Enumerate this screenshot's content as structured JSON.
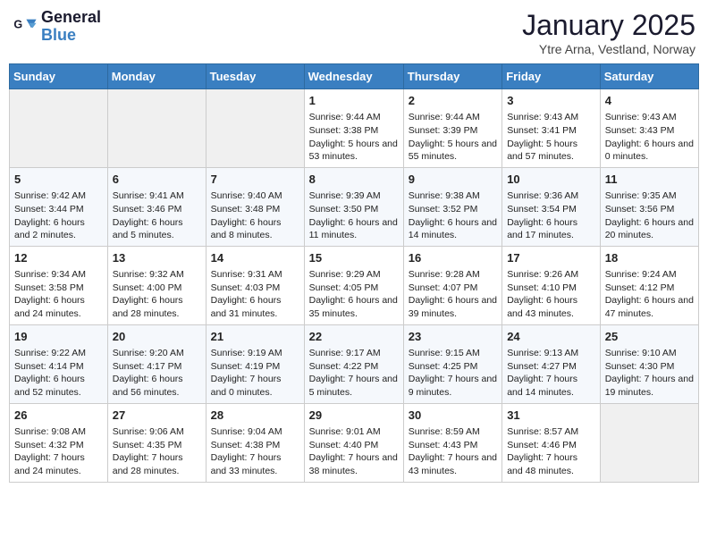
{
  "logo": {
    "line1": "General",
    "line2": "Blue"
  },
  "title": "January 2025",
  "subtitle": "Ytre Arna, Vestland, Norway",
  "days_of_week": [
    "Sunday",
    "Monday",
    "Tuesday",
    "Wednesday",
    "Thursday",
    "Friday",
    "Saturday"
  ],
  "weeks": [
    [
      {
        "day": "",
        "info": ""
      },
      {
        "day": "",
        "info": ""
      },
      {
        "day": "",
        "info": ""
      },
      {
        "day": "1",
        "info": "Sunrise: 9:44 AM\nSunset: 3:38 PM\nDaylight: 5 hours and 53 minutes."
      },
      {
        "day": "2",
        "info": "Sunrise: 9:44 AM\nSunset: 3:39 PM\nDaylight: 5 hours and 55 minutes."
      },
      {
        "day": "3",
        "info": "Sunrise: 9:43 AM\nSunset: 3:41 PM\nDaylight: 5 hours and 57 minutes."
      },
      {
        "day": "4",
        "info": "Sunrise: 9:43 AM\nSunset: 3:43 PM\nDaylight: 6 hours and 0 minutes."
      }
    ],
    [
      {
        "day": "5",
        "info": "Sunrise: 9:42 AM\nSunset: 3:44 PM\nDaylight: 6 hours and 2 minutes."
      },
      {
        "day": "6",
        "info": "Sunrise: 9:41 AM\nSunset: 3:46 PM\nDaylight: 6 hours and 5 minutes."
      },
      {
        "day": "7",
        "info": "Sunrise: 9:40 AM\nSunset: 3:48 PM\nDaylight: 6 hours and 8 minutes."
      },
      {
        "day": "8",
        "info": "Sunrise: 9:39 AM\nSunset: 3:50 PM\nDaylight: 6 hours and 11 minutes."
      },
      {
        "day": "9",
        "info": "Sunrise: 9:38 AM\nSunset: 3:52 PM\nDaylight: 6 hours and 14 minutes."
      },
      {
        "day": "10",
        "info": "Sunrise: 9:36 AM\nSunset: 3:54 PM\nDaylight: 6 hours and 17 minutes."
      },
      {
        "day": "11",
        "info": "Sunrise: 9:35 AM\nSunset: 3:56 PM\nDaylight: 6 hours and 20 minutes."
      }
    ],
    [
      {
        "day": "12",
        "info": "Sunrise: 9:34 AM\nSunset: 3:58 PM\nDaylight: 6 hours and 24 minutes."
      },
      {
        "day": "13",
        "info": "Sunrise: 9:32 AM\nSunset: 4:00 PM\nDaylight: 6 hours and 28 minutes."
      },
      {
        "day": "14",
        "info": "Sunrise: 9:31 AM\nSunset: 4:03 PM\nDaylight: 6 hours and 31 minutes."
      },
      {
        "day": "15",
        "info": "Sunrise: 9:29 AM\nSunset: 4:05 PM\nDaylight: 6 hours and 35 minutes."
      },
      {
        "day": "16",
        "info": "Sunrise: 9:28 AM\nSunset: 4:07 PM\nDaylight: 6 hours and 39 minutes."
      },
      {
        "day": "17",
        "info": "Sunrise: 9:26 AM\nSunset: 4:10 PM\nDaylight: 6 hours and 43 minutes."
      },
      {
        "day": "18",
        "info": "Sunrise: 9:24 AM\nSunset: 4:12 PM\nDaylight: 6 hours and 47 minutes."
      }
    ],
    [
      {
        "day": "19",
        "info": "Sunrise: 9:22 AM\nSunset: 4:14 PM\nDaylight: 6 hours and 52 minutes."
      },
      {
        "day": "20",
        "info": "Sunrise: 9:20 AM\nSunset: 4:17 PM\nDaylight: 6 hours and 56 minutes."
      },
      {
        "day": "21",
        "info": "Sunrise: 9:19 AM\nSunset: 4:19 PM\nDaylight: 7 hours and 0 minutes."
      },
      {
        "day": "22",
        "info": "Sunrise: 9:17 AM\nSunset: 4:22 PM\nDaylight: 7 hours and 5 minutes."
      },
      {
        "day": "23",
        "info": "Sunrise: 9:15 AM\nSunset: 4:25 PM\nDaylight: 7 hours and 9 minutes."
      },
      {
        "day": "24",
        "info": "Sunrise: 9:13 AM\nSunset: 4:27 PM\nDaylight: 7 hours and 14 minutes."
      },
      {
        "day": "25",
        "info": "Sunrise: 9:10 AM\nSunset: 4:30 PM\nDaylight: 7 hours and 19 minutes."
      }
    ],
    [
      {
        "day": "26",
        "info": "Sunrise: 9:08 AM\nSunset: 4:32 PM\nDaylight: 7 hours and 24 minutes."
      },
      {
        "day": "27",
        "info": "Sunrise: 9:06 AM\nSunset: 4:35 PM\nDaylight: 7 hours and 28 minutes."
      },
      {
        "day": "28",
        "info": "Sunrise: 9:04 AM\nSunset: 4:38 PM\nDaylight: 7 hours and 33 minutes."
      },
      {
        "day": "29",
        "info": "Sunrise: 9:01 AM\nSunset: 4:40 PM\nDaylight: 7 hours and 38 minutes."
      },
      {
        "day": "30",
        "info": "Sunrise: 8:59 AM\nSunset: 4:43 PM\nDaylight: 7 hours and 43 minutes."
      },
      {
        "day": "31",
        "info": "Sunrise: 8:57 AM\nSunset: 4:46 PM\nDaylight: 7 hours and 48 minutes."
      },
      {
        "day": "",
        "info": ""
      }
    ]
  ]
}
